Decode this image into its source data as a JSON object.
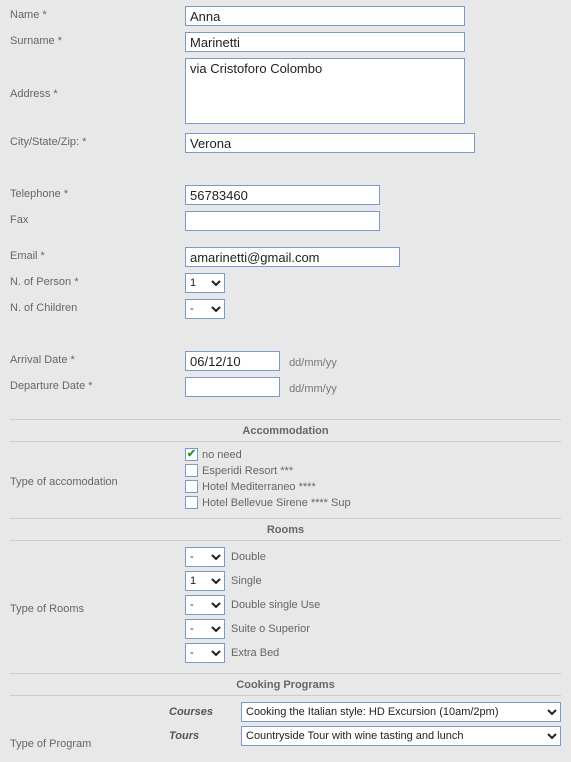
{
  "labels": {
    "name": "Name *",
    "surname": "Surname *",
    "address": "Address *",
    "city": "City/State/Zip: *",
    "telephone": "Telephone *",
    "fax": "Fax",
    "email": "Email *",
    "nperson": "N. of Person *",
    "nchildren": "N. of Children",
    "arrival": "Arrival Date *",
    "departure": "Departure Date *",
    "datehint": "dd/mm/yy",
    "accommodation_head": "Accommodation",
    "type_accom": "Type of accomodation",
    "rooms_head": "Rooms",
    "type_rooms": "Type of Rooms",
    "cooking_head": "Cooking Programs",
    "type_program": "Type of Program",
    "courses": "Courses",
    "tours": "Tours"
  },
  "values": {
    "name": "Anna",
    "surname": "Marinetti",
    "address": "via Cristoforo Colombo",
    "city": "Verona",
    "telephone": "56783460",
    "fax": "",
    "email": "amarinetti@gmail.com",
    "nperson": "1",
    "nchildren": "-",
    "arrival": "06/12/10",
    "departure": ""
  },
  "accom_options": [
    {
      "label": "no need",
      "checked": true
    },
    {
      "label": "Esperidi Resort ***",
      "checked": false
    },
    {
      "label": "Hotel Mediterraneo ****",
      "checked": false
    },
    {
      "label": "Hotel Bellevue Sirene **** Sup",
      "checked": false
    }
  ],
  "rooms": [
    {
      "sel": "-",
      "label": "Double"
    },
    {
      "sel": "1",
      "label": "Single"
    },
    {
      "sel": "-",
      "label": "Double single Use"
    },
    {
      "sel": "-",
      "label": "Suite o Superior"
    },
    {
      "sel": "-",
      "label": "Extra Bed"
    }
  ],
  "programs": {
    "courses": "Cooking the Italian style: HD Excursion (10am/2pm)",
    "tours": "Countryside Tour with wine tasting and lunch"
  }
}
